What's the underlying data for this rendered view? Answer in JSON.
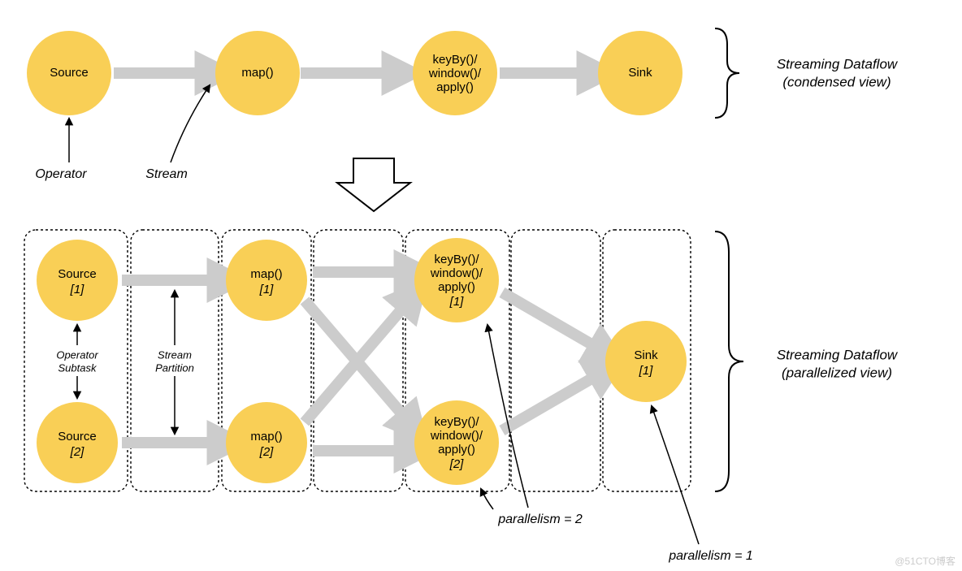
{
  "top": {
    "source": "Source",
    "map": "map()",
    "key_l1": "keyBy()/",
    "key_l2": "window()/",
    "key_l3": "apply()",
    "sink": "Sink"
  },
  "title_top_l1": "Streaming Dataflow",
  "title_top_l2": "(condensed view)",
  "label_operator": "Operator",
  "label_stream": "Stream",
  "bottom": {
    "source1_l1": "Source",
    "source1_l2": "[1]",
    "source2_l1": "Source",
    "source2_l2": "[2]",
    "map1_l1": "map()",
    "map1_l2": "[1]",
    "map2_l1": "map()",
    "map2_l2": "[2]",
    "key1_l1": "keyBy()/",
    "key1_l2": "window()/",
    "key1_l3": "apply()",
    "key1_l4": "[1]",
    "key2_l1": "keyBy()/",
    "key2_l2": "window()/",
    "key2_l3": "apply()",
    "key2_l4": "[2]",
    "sink_l1": "Sink",
    "sink_l2": "[1]"
  },
  "label_op_subtask_l1": "Operator",
  "label_op_subtask_l2": "Subtask",
  "label_stream_partition_l1": "Stream",
  "label_stream_partition_l2": "Partition",
  "title_bottom_l1": "Streaming Dataflow",
  "title_bottom_l2": "(parallelized view)",
  "label_parallelism2": "parallelism = 2",
  "label_parallelism1": "parallelism = 1",
  "watermark": "@51CTO博客",
  "colors": {
    "node_fill": "#F9CF56",
    "arrow_gray": "#CCCCCC",
    "line_black": "#000000",
    "dash": "#000000"
  }
}
